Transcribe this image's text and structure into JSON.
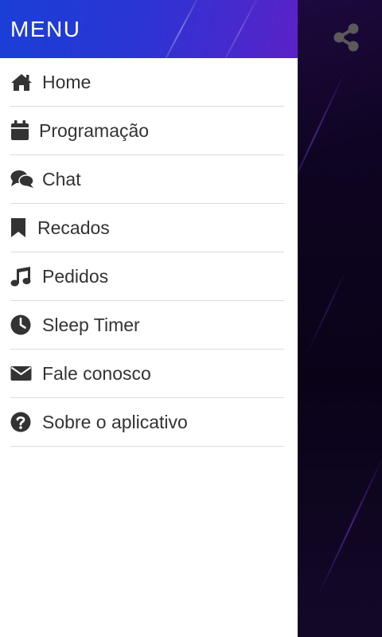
{
  "drawer": {
    "title": "MENU",
    "items": [
      {
        "label": "Home",
        "icon": "home-icon"
      },
      {
        "label": "Programação",
        "icon": "calendar-icon"
      },
      {
        "label": "Chat",
        "icon": "chat-bubbles-icon"
      },
      {
        "label": "Recados",
        "icon": "bookmark-icon"
      },
      {
        "label": "Pedidos",
        "icon": "music-note-icon"
      },
      {
        "label": "Sleep Timer",
        "icon": "clock-icon"
      },
      {
        "label": "Fale conosco",
        "icon": "envelope-icon"
      },
      {
        "label": "Sobre o aplicativo",
        "icon": "question-circle-icon"
      }
    ]
  },
  "background_app": {
    "share_icon": "share-icon"
  },
  "colors": {
    "header_gradient_start": "#1a3fd6",
    "header_gradient_end": "#5a22c8",
    "menu_text": "#333333",
    "divider": "#dcdcdc",
    "app_background": "#0c0520"
  }
}
